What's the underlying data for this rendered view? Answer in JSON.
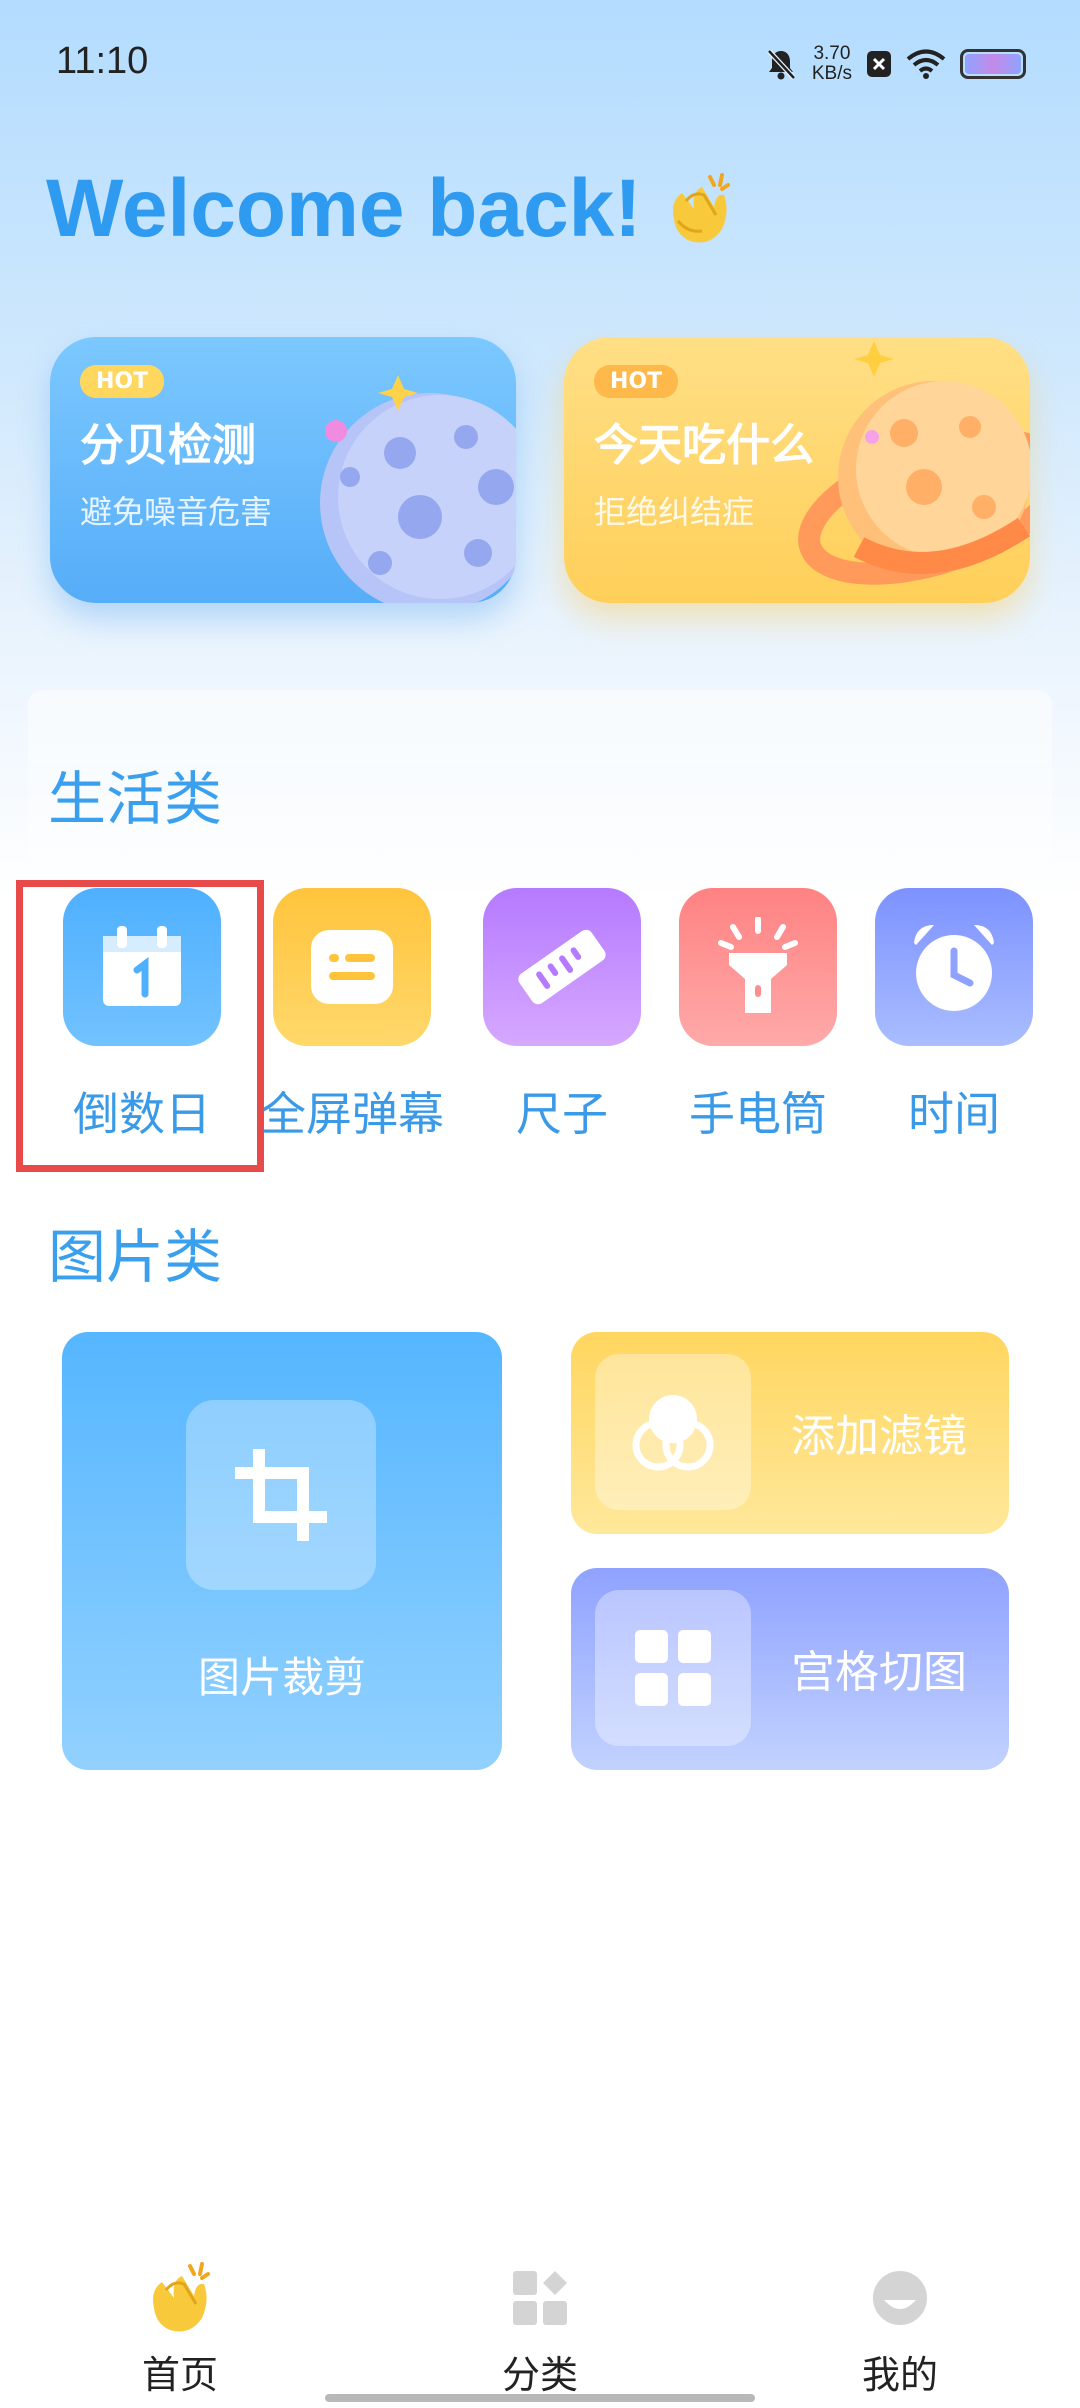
{
  "status_bar": {
    "time": "11:10",
    "net_speed_value": "3.70",
    "net_speed_unit": "KB/s",
    "icons": [
      "mute-icon",
      "close-box-icon",
      "wifi-icon",
      "battery-icon"
    ]
  },
  "header": {
    "welcome_text": "Welcome back!",
    "welcome_icon": "clapping-hands-icon"
  },
  "hot_cards": [
    {
      "badge": "HOT",
      "title": "分贝检测",
      "subtitle": "避免噪音危害",
      "color": "#56adf8"
    },
    {
      "badge": "HOT",
      "title": "今天吃什么",
      "subtitle": "拒绝纠结症",
      "color": "#ffcf59"
    }
  ],
  "life_section": {
    "title": "生活类",
    "tools": [
      {
        "label": "倒数日",
        "icon": "calendar-icon",
        "color": "#5bb7ff"
      },
      {
        "label": "全屏弹幕",
        "icon": "message-icon",
        "color": "#ffcc4d"
      },
      {
        "label": "尺子",
        "icon": "ruler-icon",
        "color": "#c38cff"
      },
      {
        "label": "手电筒",
        "icon": "flashlight-icon",
        "color": "#ff8f8f"
      },
      {
        "label": "时间",
        "icon": "alarm-clock-icon",
        "color": "#8fa2ff"
      }
    ]
  },
  "picture_section": {
    "title": "图片类",
    "cards": [
      {
        "label": "图片裁剪",
        "icon": "crop-icon"
      },
      {
        "label": "添加滤镜",
        "icon": "filter-icon"
      },
      {
        "label": "宫格切图",
        "icon": "grid-icon"
      }
    ]
  },
  "bottom_nav": {
    "items": [
      {
        "label": "首页",
        "icon": "clapping-hands-icon",
        "active": true
      },
      {
        "label": "分类",
        "icon": "category-icon",
        "active": false
      },
      {
        "label": "我的",
        "icon": "profile-icon",
        "active": false
      }
    ]
  },
  "highlight_color": "#e84a4a"
}
